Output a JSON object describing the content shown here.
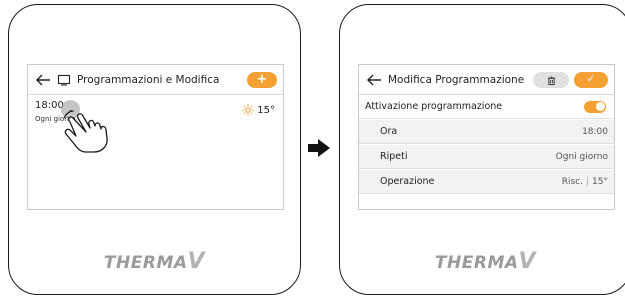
{
  "left_screen": {
    "title": "Programmazioni e Modifica",
    "add_label": "+",
    "schedule": {
      "time": "18:00",
      "days": "Ogni giorno",
      "temp": "15°"
    }
  },
  "right_screen": {
    "title": "Modifica Programmazione",
    "confirm_label": "✓",
    "activation_label": "Attivazione programmazione",
    "activation_on": true,
    "rows": [
      {
        "label": "Ora",
        "value": "18:00"
      },
      {
        "label": "Ripeti",
        "value": "Ogni giorno"
      },
      {
        "label": "Operazione",
        "value_mode": "Risc.",
        "value_temp": "15°"
      }
    ]
  },
  "brand": {
    "logo_text": "THERMA",
    "logo_v": "V"
  },
  "colors": {
    "accent": "#f5a033",
    "logo": "#9a9a9a",
    "sub_row_bg": "#f2f2f2"
  },
  "icons": [
    "back-arrow-icon",
    "schedule-icon",
    "sun-icon",
    "tap-hand-icon",
    "delete-icon",
    "checkmark-icon",
    "flow-arrow-icon"
  ]
}
